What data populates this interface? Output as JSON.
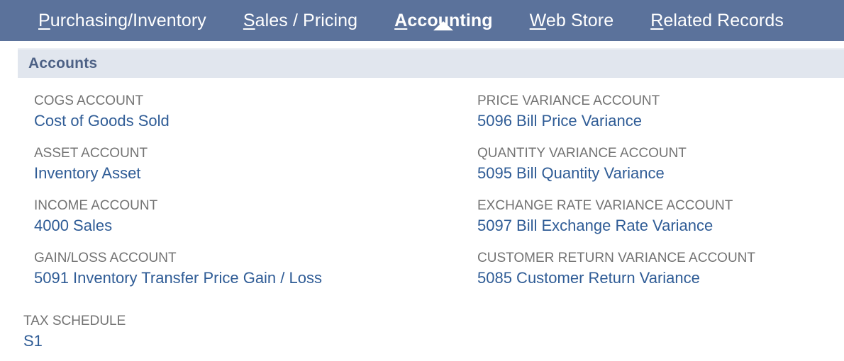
{
  "tabbar": {
    "background_color": "#5b729b",
    "tabs": [
      {
        "label": "Purchasing/Inventory",
        "accesskey": "P",
        "active": false
      },
      {
        "label": "Sales / Pricing",
        "accesskey": "S",
        "active": false
      },
      {
        "label": "Accounting",
        "accesskey": "A",
        "active": true
      },
      {
        "label": "Web Store",
        "accesskey": "W",
        "active": false
      },
      {
        "label": "Related Records",
        "accesskey": "R",
        "active": false
      }
    ]
  },
  "section": {
    "title": "Accounts",
    "band_color": "#e1e6ee",
    "title_color": "#4d6185"
  },
  "colors": {
    "label": "#737373",
    "value_link": "#2f5c96"
  },
  "fields": {
    "left": [
      {
        "label": "COGS ACCOUNT",
        "value": "Cost of Goods Sold"
      },
      {
        "label": "ASSET ACCOUNT",
        "value": "Inventory Asset"
      },
      {
        "label": "INCOME ACCOUNT",
        "value": "4000 Sales"
      },
      {
        "label": "GAIN/LOSS ACCOUNT",
        "value": "5091 Inventory Transfer Price Gain / Loss"
      }
    ],
    "right": [
      {
        "label": "PRICE VARIANCE ACCOUNT",
        "value": "5096 Bill Price Variance"
      },
      {
        "label": "QUANTITY VARIANCE ACCOUNT",
        "value": "5095 Bill Quantity Variance"
      },
      {
        "label": "EXCHANGE RATE VARIANCE ACCOUNT",
        "value": "5097 Bill Exchange Rate Variance"
      },
      {
        "label": "CUSTOMER RETURN VARIANCE ACCOUNT",
        "value": "5085 Customer Return Variance"
      }
    ],
    "bottom": {
      "label": "TAX SCHEDULE",
      "value": "S1"
    }
  }
}
